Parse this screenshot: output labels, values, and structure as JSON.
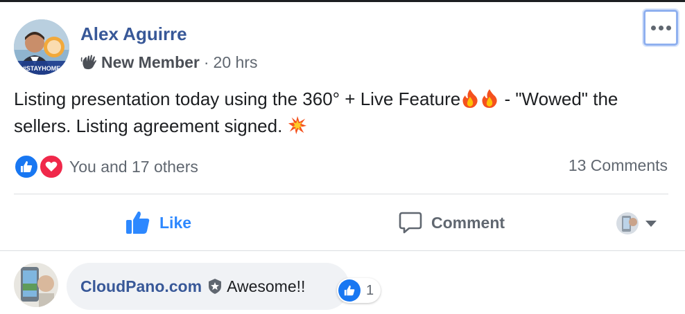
{
  "post": {
    "author": "Alex Aguirre",
    "avatar_badge_text": "#STAYHOME",
    "badge": "New Member",
    "separator": "·",
    "time": "20 hrs",
    "text_part1": "Listing presentation today using the 360° + Live Feature",
    "text_part2": " - \"Wowed\" the sellers. Listing agreement signed. ",
    "reactions_text": "You and 17 others",
    "comments_count": "13 Comments"
  },
  "actions": {
    "like_label": "Like",
    "comment_label": "Comment"
  },
  "comment": {
    "author": "CloudPano.com",
    "text": "Awesome!!",
    "reaction_count": "1"
  },
  "colors": {
    "name_blue": "#385898",
    "like_blue": "#2d88ff",
    "love_red": "#f0284a",
    "secondary_gray": "#606770"
  },
  "icons": [
    "more-options-icon",
    "wave-icon",
    "fire-icon",
    "explosion-icon",
    "like-reaction-icon",
    "love-reaction-icon",
    "thumbs-up-icon",
    "comment-bubble-icon",
    "dropdown-caret-icon",
    "verified-shield-icon"
  ]
}
